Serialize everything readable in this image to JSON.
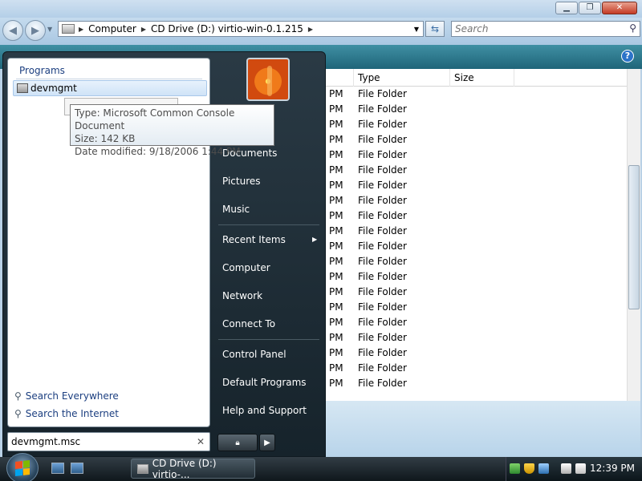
{
  "explorer": {
    "window_buttons": {
      "minimize": "▁",
      "maximize": "❐",
      "close": "✕"
    },
    "address": {
      "segments": [
        "Computer",
        "CD Drive (D:) virtio-win-0.1.215"
      ]
    },
    "search_placeholder": "Search",
    "columns": [
      "Type",
      "Size"
    ],
    "rows": [
      {
        "date": "PM",
        "type": "File Folder"
      },
      {
        "date": "PM",
        "type": "File Folder"
      },
      {
        "date": "PM",
        "type": "File Folder"
      },
      {
        "date": "PM",
        "type": "File Folder"
      },
      {
        "date": "PM",
        "type": "File Folder"
      },
      {
        "date": "PM",
        "type": "File Folder"
      },
      {
        "date": "PM",
        "type": "File Folder"
      },
      {
        "date": "PM",
        "type": "File Folder"
      },
      {
        "date": "PM",
        "type": "File Folder"
      },
      {
        "date": "PM",
        "type": "File Folder"
      },
      {
        "date": "PM",
        "type": "File Folder"
      },
      {
        "date": "PM",
        "type": "File Folder"
      },
      {
        "date": "PM",
        "type": "File Folder"
      },
      {
        "date": "PM",
        "type": "File Folder"
      },
      {
        "date": "PM",
        "type": "File Folder"
      },
      {
        "date": "PM",
        "type": "File Folder"
      },
      {
        "date": "PM",
        "type": "File Folder"
      },
      {
        "date": "PM",
        "type": "File Folder"
      },
      {
        "date": "PM",
        "type": "File Folder"
      },
      {
        "date": "PM",
        "type": "File Folder"
      }
    ]
  },
  "start_menu": {
    "programs_label": "Programs",
    "program_item": "devmgmt",
    "search_links": [
      "Search Everywhere",
      "Search the Internet"
    ],
    "search_value": "devmgmt.msc",
    "right_items": [
      "Documents",
      "Pictures",
      "Music",
      "Recent Items",
      "Computer",
      "Network",
      "Connect To",
      "Control Panel",
      "Default Programs",
      "Help and Support"
    ]
  },
  "tooltip": {
    "type_line": "Type: Microsoft Common Console Document",
    "size_line": "Size: 142 KB",
    "date_line": "Date modified: 9/18/2006 1:44 PM"
  },
  "taskbar": {
    "task_label": "CD Drive (D:) virtio-...",
    "clock": "12:39 PM"
  },
  "colors": {
    "start_menu_bg": "#1e2b33",
    "toolbar": "#2f7a8e",
    "link_blue": "#1c3f80"
  }
}
